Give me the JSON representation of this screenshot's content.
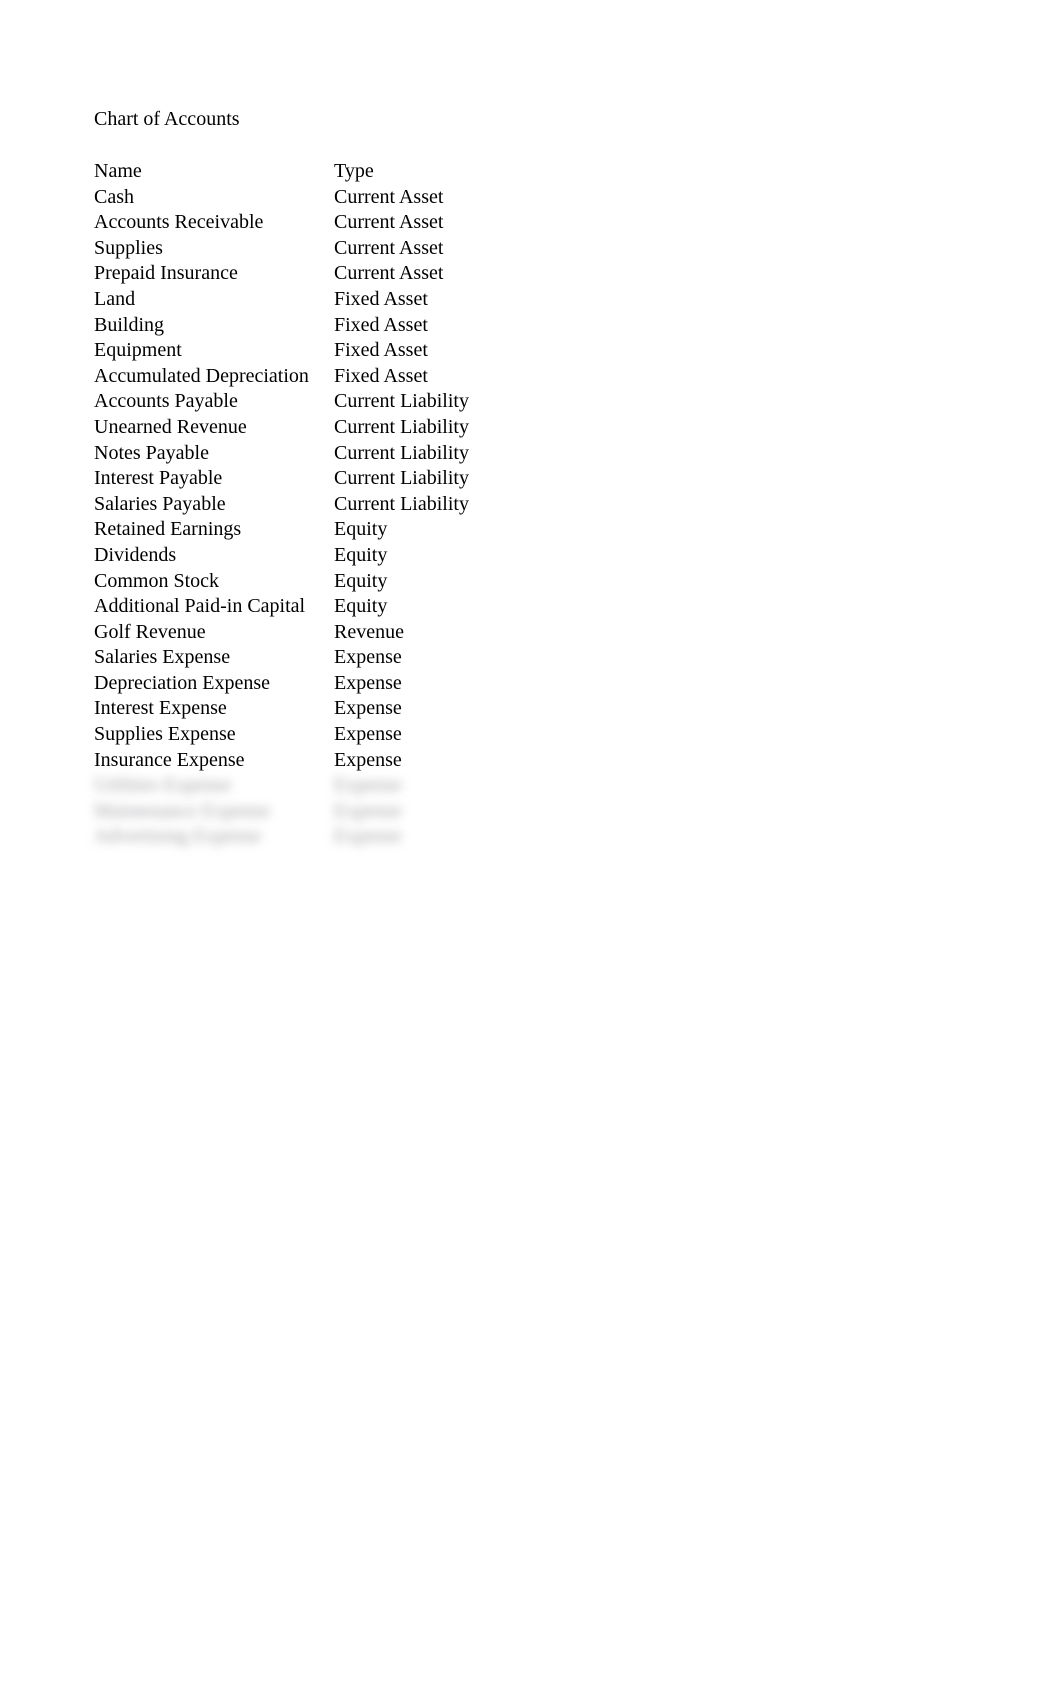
{
  "title": "Chart of Accounts",
  "headers": {
    "name": "Name",
    "type": "Type"
  },
  "rows": [
    {
      "name": "Cash",
      "type": "Current Asset"
    },
    {
      "name": "Accounts Receivable",
      "type": "Current Asset"
    },
    {
      "name": "Supplies",
      "type": "Current Asset"
    },
    {
      "name": "Prepaid Insurance",
      "type": "Current Asset"
    },
    {
      "name": "Land",
      "type": "Fixed Asset"
    },
    {
      "name": "Building",
      "type": "Fixed Asset"
    },
    {
      "name": "Equipment",
      "type": "Fixed Asset"
    },
    {
      "name": "Accumulated Depreciation",
      "type": "Fixed Asset"
    },
    {
      "name": "Accounts Payable",
      "type": "Current Liability"
    },
    {
      "name": "Unearned Revenue",
      "type": "Current Liability"
    },
    {
      "name": "Notes Payable",
      "type": "Current Liability"
    },
    {
      "name": "Interest Payable",
      "type": "Current Liability"
    },
    {
      "name": "Salaries Payable",
      "type": "Current Liability"
    },
    {
      "name": "Retained Earnings",
      "type": "Equity"
    },
    {
      "name": "Dividends",
      "type": "Equity"
    },
    {
      "name": "Common Stock",
      "type": "Equity"
    },
    {
      "name": "Additional Paid-in Capital",
      "type": "Equity"
    },
    {
      "name": "Golf Revenue",
      "type": "Revenue"
    },
    {
      "name": "Salaries Expense",
      "type": "Expense"
    },
    {
      "name": "Depreciation Expense",
      "type": "Expense"
    },
    {
      "name": "Interest Expense",
      "type": "Expense"
    },
    {
      "name": "Supplies Expense",
      "type": "Expense"
    },
    {
      "name": "Insurance Expense",
      "type": "Expense"
    }
  ],
  "blurred_rows": [
    {
      "name": "Utilities Expense",
      "type": "Expense"
    },
    {
      "name": "Maintenance Expense",
      "type": "Expense"
    },
    {
      "name": "Advertising Expense",
      "type": "Expense"
    }
  ]
}
